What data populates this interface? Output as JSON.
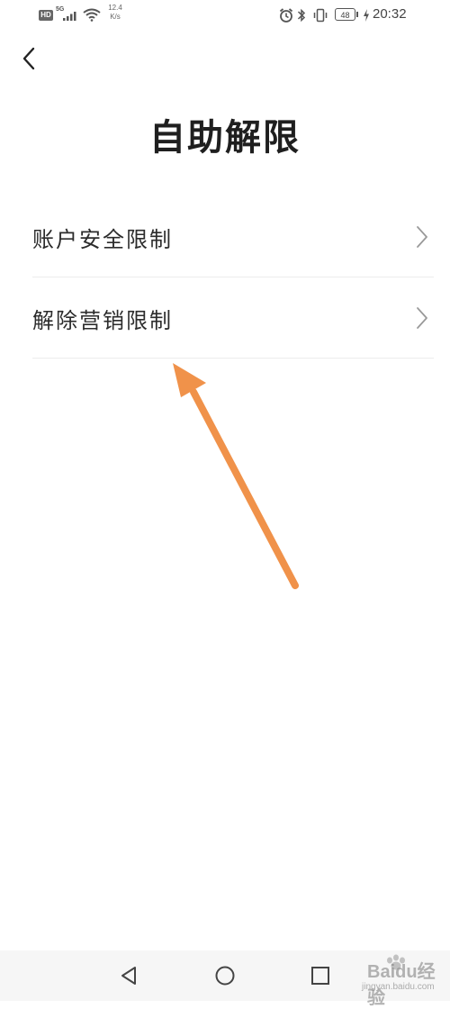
{
  "status_bar": {
    "hd": "HD",
    "network": "5G",
    "speed_value": "12.4",
    "speed_unit": "K/s",
    "battery": "48",
    "time": "20:32"
  },
  "header": {
    "back_icon": "chevron-left-icon",
    "title": "自助解限"
  },
  "menu": {
    "items": [
      {
        "label": "账户安全限制",
        "icon": "chevron-right-icon"
      },
      {
        "label": "解除营销限制",
        "icon": "chevron-right-icon"
      }
    ]
  },
  "annotation": {
    "color": "#f0924a",
    "icon": "arrow-icon"
  },
  "nav_bar": {
    "back_icon": "triangle-back-icon",
    "home_icon": "circle-home-icon",
    "recent_icon": "square-recent-icon"
  },
  "watermark": {
    "brand": "Baidu",
    "suffix": "经验",
    "url": "jingyan.baidu.com"
  }
}
